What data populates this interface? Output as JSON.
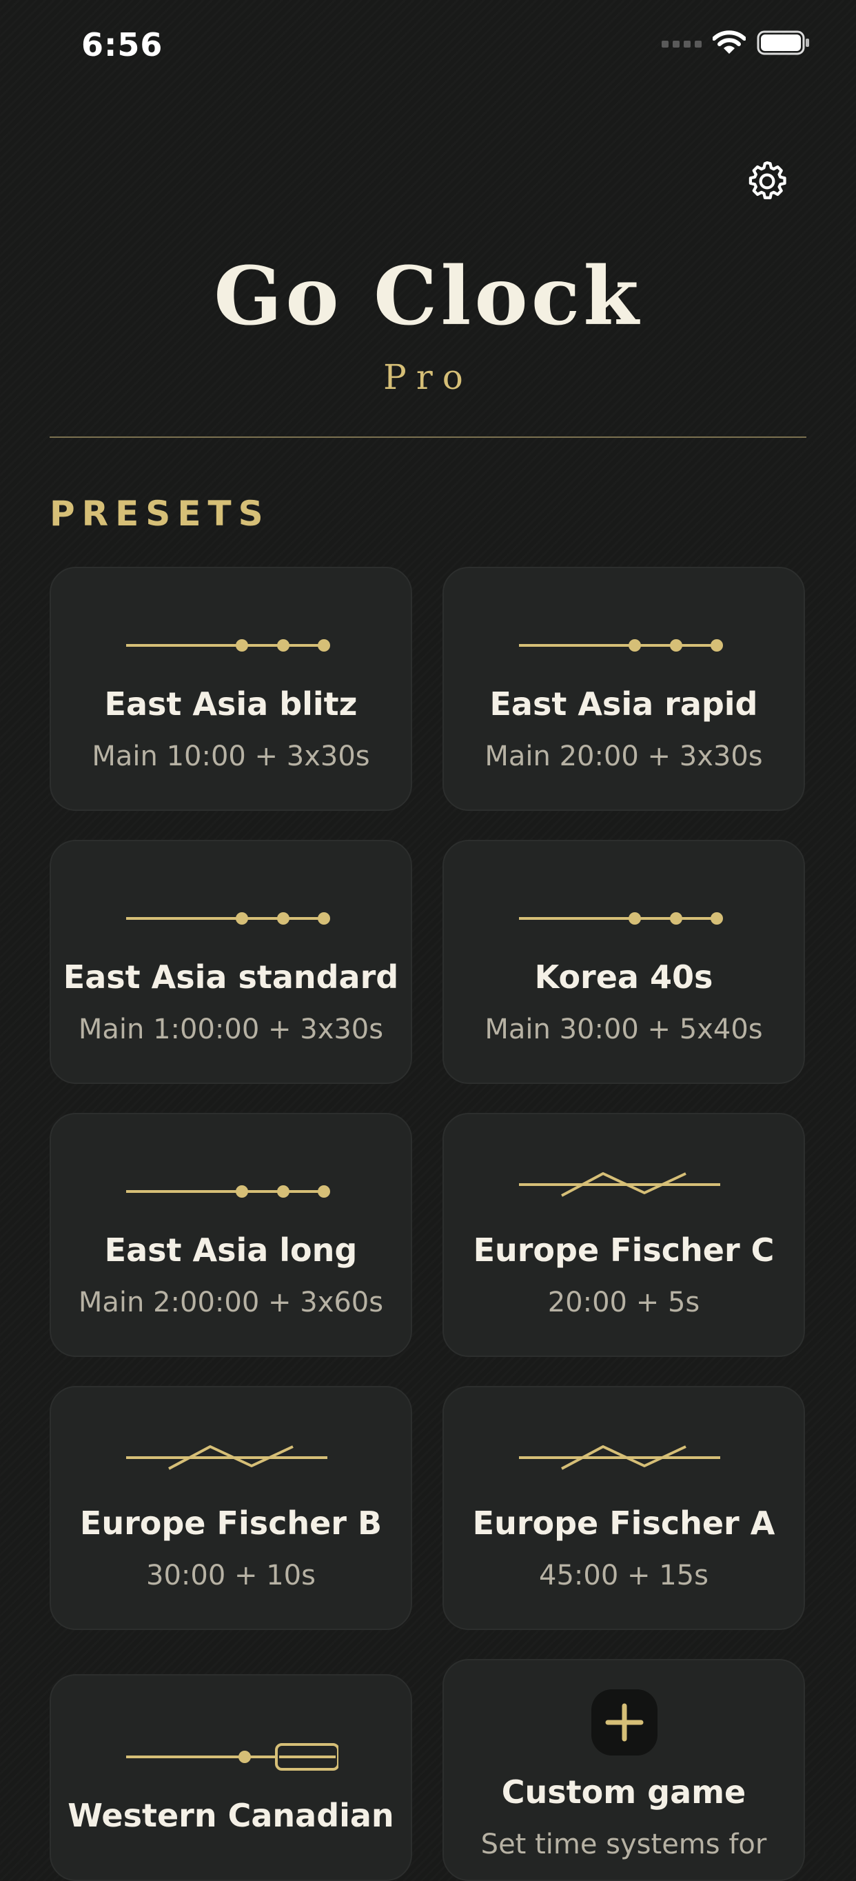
{
  "status_bar": {
    "time": "6:56"
  },
  "app": {
    "title": "Go Clock",
    "subtitle": "Pro"
  },
  "presets": {
    "header": "PRESETS",
    "items": [
      {
        "name": "East Asia blitz",
        "detail": "Main 10:00 + 3x30s",
        "icon": "byoyomi-line-icon"
      },
      {
        "name": "East Asia rapid",
        "detail": "Main 20:00 + 3x30s",
        "icon": "byoyomi-line-icon"
      },
      {
        "name": "East Asia standard",
        "detail": "Main 1:00:00 + 3x30s",
        "icon": "byoyomi-line-icon"
      },
      {
        "name": "Korea 40s",
        "detail": "Main 30:00 + 5x40s",
        "icon": "byoyomi-line-icon"
      },
      {
        "name": "East Asia long",
        "detail": "Main 2:00:00 + 3x60s",
        "icon": "byoyomi-line-icon"
      },
      {
        "name": "Europe Fischer C",
        "detail": "20:00 + 5s",
        "icon": "fischer-zigzag-icon"
      },
      {
        "name": "Europe Fischer B",
        "detail": "30:00 + 10s",
        "icon": "fischer-zigzag-icon"
      },
      {
        "name": "Europe Fischer A",
        "detail": "45:00 + 15s",
        "icon": "fischer-zigzag-icon"
      },
      {
        "name": "Western Canadian",
        "detail": "",
        "icon": "canadian-line-icon"
      }
    ],
    "custom": {
      "name": "Custom game",
      "detail": "Set time systems for",
      "icon": "plus-icon"
    }
  },
  "colors": {
    "accent": "#d6bf77",
    "background": "#191a19",
    "card": "#232524",
    "text": "#f4f0e6",
    "muted": "#b7b2a4"
  }
}
